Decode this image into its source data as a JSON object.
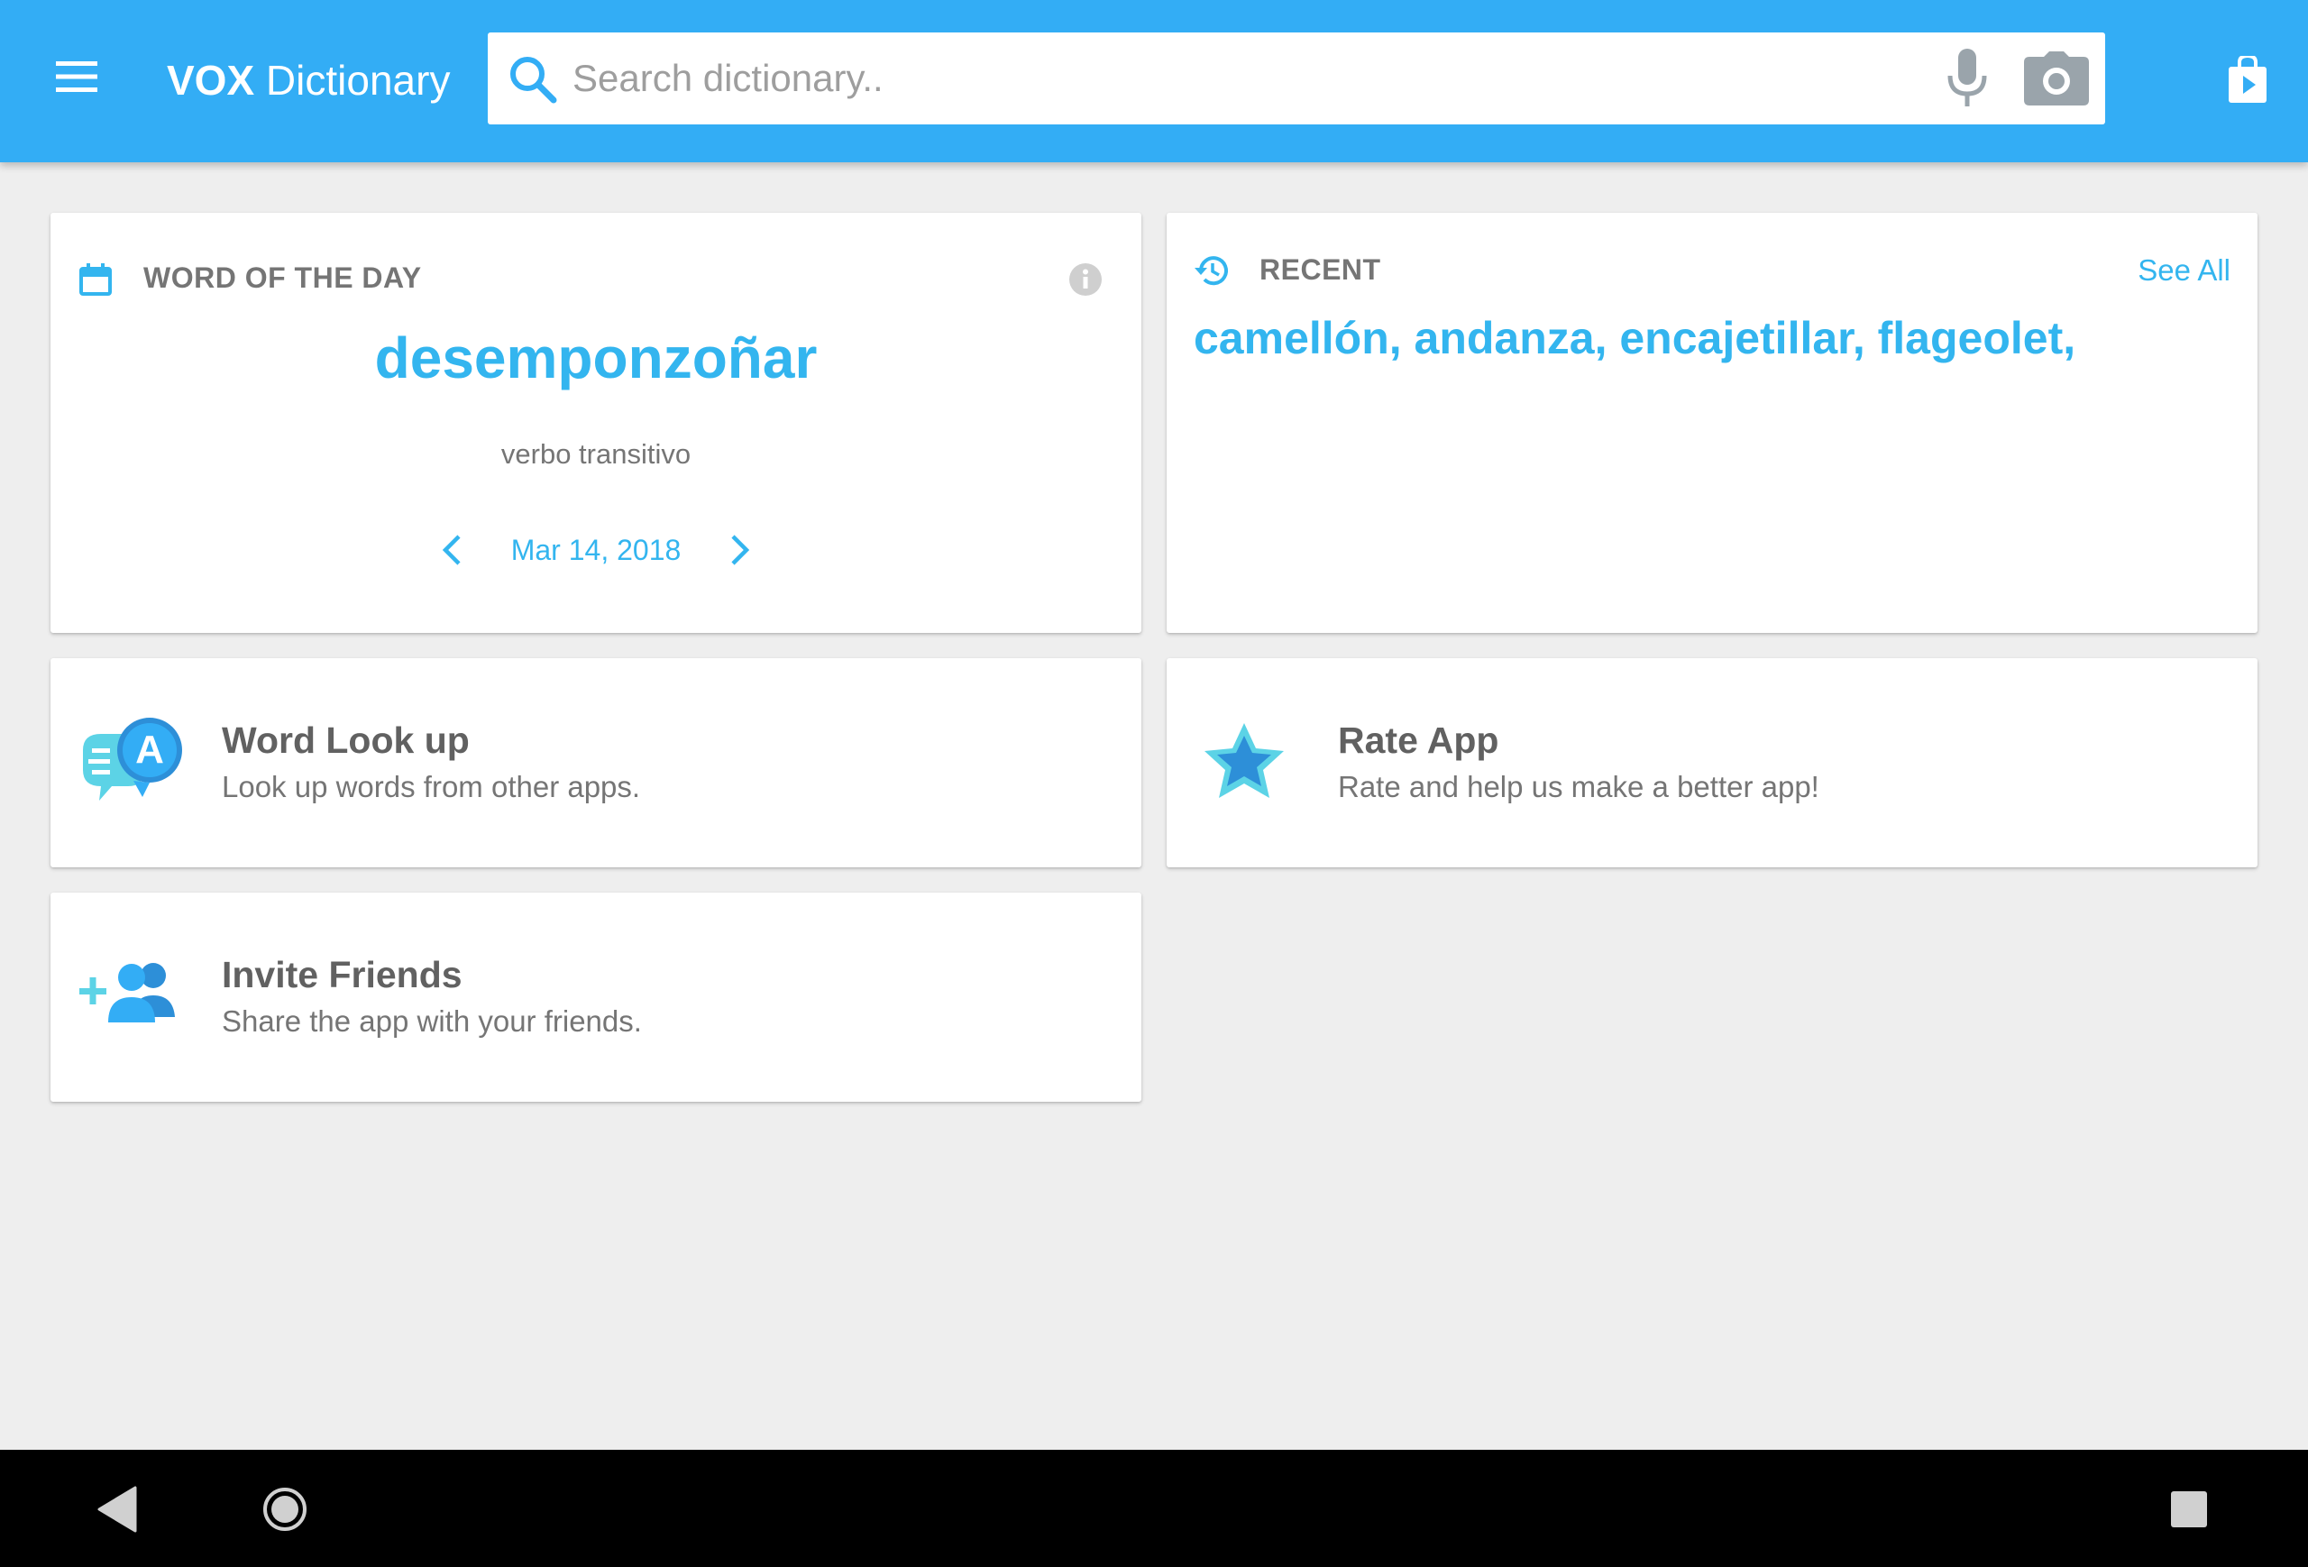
{
  "app": {
    "title_bold": "VOX",
    "title_rest": " Dictionary",
    "accent_color": "#33adf5",
    "link_color": "#33b5ef"
  },
  "search": {
    "placeholder": "Search dictionary..",
    "value": ""
  },
  "icons": {
    "menu": "hamburger-menu-icon",
    "search": "magnifier-icon",
    "mic": "microphone-icon",
    "camera": "camera-icon",
    "store": "play-store-bag-icon",
    "calendar": "calendar-icon",
    "info": "info-icon",
    "history": "history-clock-icon"
  },
  "word_of_the_day": {
    "heading": "WORD OF THE DAY",
    "word": "desemponzoñar",
    "part_of_speech": "verbo transitivo",
    "date": "Mar 14, 2018"
  },
  "recent": {
    "heading": "RECENT",
    "see_all": "See All",
    "words": "camellón, andanza, encajetillar, flageolet,"
  },
  "features": {
    "lookup": {
      "title": "Word Look up",
      "subtitle": "Look up words from other apps.",
      "icon_letter": "A"
    },
    "rate": {
      "title": "Rate App",
      "subtitle": "Rate and help us make a better app!"
    },
    "invite": {
      "title": "Invite Friends",
      "subtitle": "Share the app with your friends."
    }
  },
  "system_nav": {
    "back": "back-triangle-icon",
    "home": "home-circle-icon",
    "recents": "recents-square-icon"
  }
}
